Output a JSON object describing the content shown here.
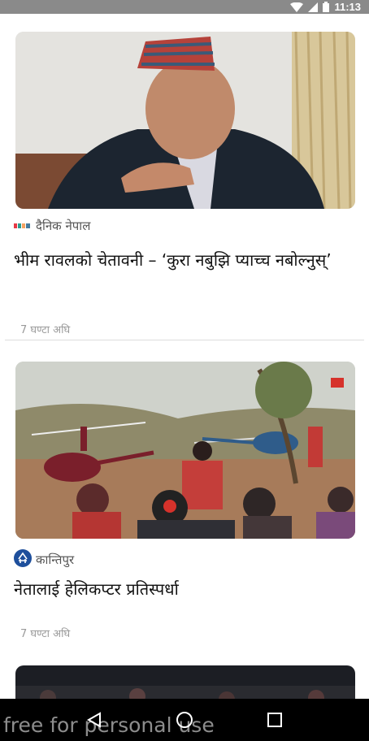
{
  "status_bar": {
    "time": "11:13",
    "icons": [
      "wifi-icon",
      "signal-icon",
      "battery-icon"
    ]
  },
  "feed": {
    "cards": [
      {
        "source": "दैनिक नेपाल",
        "source_icon": "dainik-nepal-logo",
        "headline": "भीम रावलको चेतावनी – ‘कुरा नबुझि प्याच्च नबोल्नुस्’",
        "time": "7 घण्टा अघि"
      },
      {
        "source": "कान्तिपुर",
        "source_icon": "kantipur-logo",
        "headline": "नेतालाई हेलिकप्टर प्रतिस्पर्धा",
        "time": "7 घण्टा अघि"
      }
    ]
  },
  "nav": {
    "buttons": [
      "back-icon",
      "home-icon",
      "recents-icon"
    ]
  },
  "watermark": "free for personal use"
}
